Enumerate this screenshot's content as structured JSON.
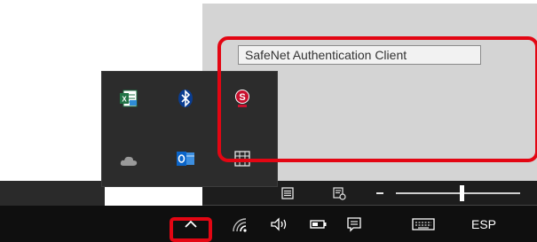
{
  "tooltip": {
    "text": "SafeNet Authentication Client"
  },
  "tray_overflow": {
    "icons": [
      "excel-icon",
      "bluetooth-icon",
      "safenet-icon",
      "onedrive-icon",
      "outlook-icon",
      "grid-app-icon"
    ]
  },
  "taskbar": {
    "language": "ESP",
    "icons": [
      "show-hidden-icons-chevron",
      "network-icon",
      "volume-icon",
      "battery-icon",
      "action-center-icon",
      "keyboard-icon"
    ]
  },
  "colors": {
    "highlight": "#e30613",
    "taskbar": "#0f0f0f",
    "popup": "#2c2c2c",
    "excel_green": "#217346",
    "outlook_blue": "#0a64c8",
    "safenet_red": "#c8102e"
  }
}
